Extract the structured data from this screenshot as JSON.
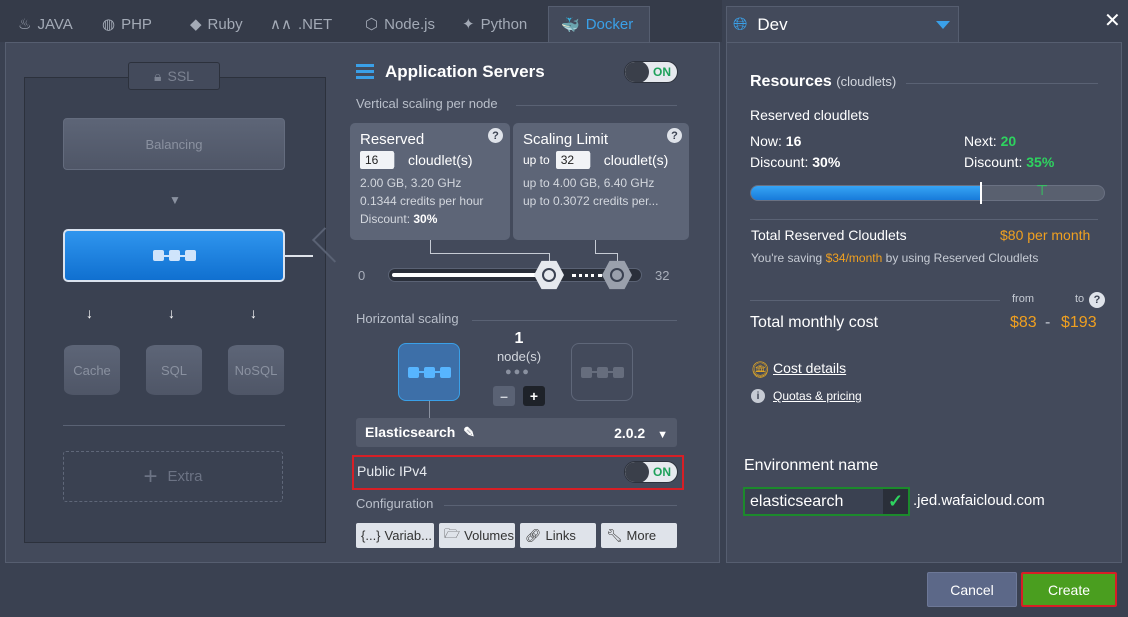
{
  "tabs": [
    {
      "label": "JAVA",
      "icon": "java-icon"
    },
    {
      "label": "PHP",
      "icon": "php-icon"
    },
    {
      "label": "Ruby",
      "icon": "ruby-icon"
    },
    {
      "label": ".NET",
      "icon": "dotnet-icon"
    },
    {
      "label": "Node.js",
      "icon": "nodejs-icon"
    },
    {
      "label": "Python",
      "icon": "python-icon"
    },
    {
      "label": "Docker",
      "icon": "docker-icon",
      "active": true
    }
  ],
  "topology": {
    "ssl_label": "SSL",
    "balancing_label": "Balancing",
    "cache_label": "Cache",
    "sql_label": "SQL",
    "nosql_label": "NoSQL",
    "extra_label": "Extra"
  },
  "app_servers": {
    "title": "Application Servers",
    "toggle": "ON",
    "vertical_label": "Vertical scaling per node",
    "reserved": {
      "title": "Reserved",
      "value": "16",
      "unit": "cloudlet(s)",
      "specs": "2.00 GB, 3.20 GHz",
      "credits": "0.1344 credits per hour",
      "discount_label": "Discount:",
      "discount_value": "30%"
    },
    "limit": {
      "title": "Scaling Limit",
      "prefix": "up to",
      "value": "32",
      "unit": "cloudlet(s)",
      "specs": "up to 4.00 GB, 6.40 GHz",
      "credits": "up to 0.3072 credits per..."
    },
    "slider": {
      "min": "0",
      "max": "32",
      "reserved_value": 16,
      "limit_value": 32
    },
    "horizontal_label": "Horizontal scaling",
    "nodes_count": "1",
    "nodes_label": "node(s)",
    "minus": "–",
    "plus": "+",
    "engine": "Elasticsearch",
    "version": "2.0.2",
    "public_ipv4_label": "Public IPv4",
    "public_ipv4_toggle": "ON",
    "configuration_label": "Configuration",
    "config_buttons": [
      {
        "label": "Variab...",
        "icon": "variables-icon"
      },
      {
        "label": "Volumes",
        "icon": "folder-icon"
      },
      {
        "label": "Links",
        "icon": "link-icon"
      },
      {
        "label": "More",
        "icon": "wrench-icon"
      }
    ]
  },
  "environment": {
    "region": "Dev",
    "resources_title": "Resources",
    "resources_unit": "(cloudlets)",
    "reserved_cloudlets_label": "Reserved cloudlets",
    "now_label": "Now:",
    "now_value": "16",
    "next_label": "Next:",
    "next_value": "20",
    "discount_label": "Discount:",
    "discount_now": "30%",
    "discount_next": "35%",
    "reserved_fraction": 0.65,
    "total_reserved_label": "Total Reserved Cloudlets",
    "total_reserved_price": "$80 per month",
    "saving_prefix": "You're saving",
    "saving_amount": "$34/month",
    "saving_suffix": "by using Reserved Cloudlets",
    "from_label": "from",
    "to_label": "to",
    "total_monthly_label": "Total monthly cost",
    "cost_from": "$83",
    "cost_sep": "-",
    "cost_to": "$193",
    "cost_details_link": "Cost details",
    "quotas_link": "Quotas & pricing",
    "env_name_label": "Environment name",
    "env_name_value": "elasticsearch",
    "domain_suffix": ".jed.wafaicloud.com"
  },
  "actions": {
    "cancel": "Cancel",
    "create": "Create"
  },
  "colors": {
    "accent": "#3aa0e8",
    "create": "#4a9e1f",
    "highlight": "#d71f26",
    "price": "#f0a020",
    "next": "#2ed35f"
  }
}
